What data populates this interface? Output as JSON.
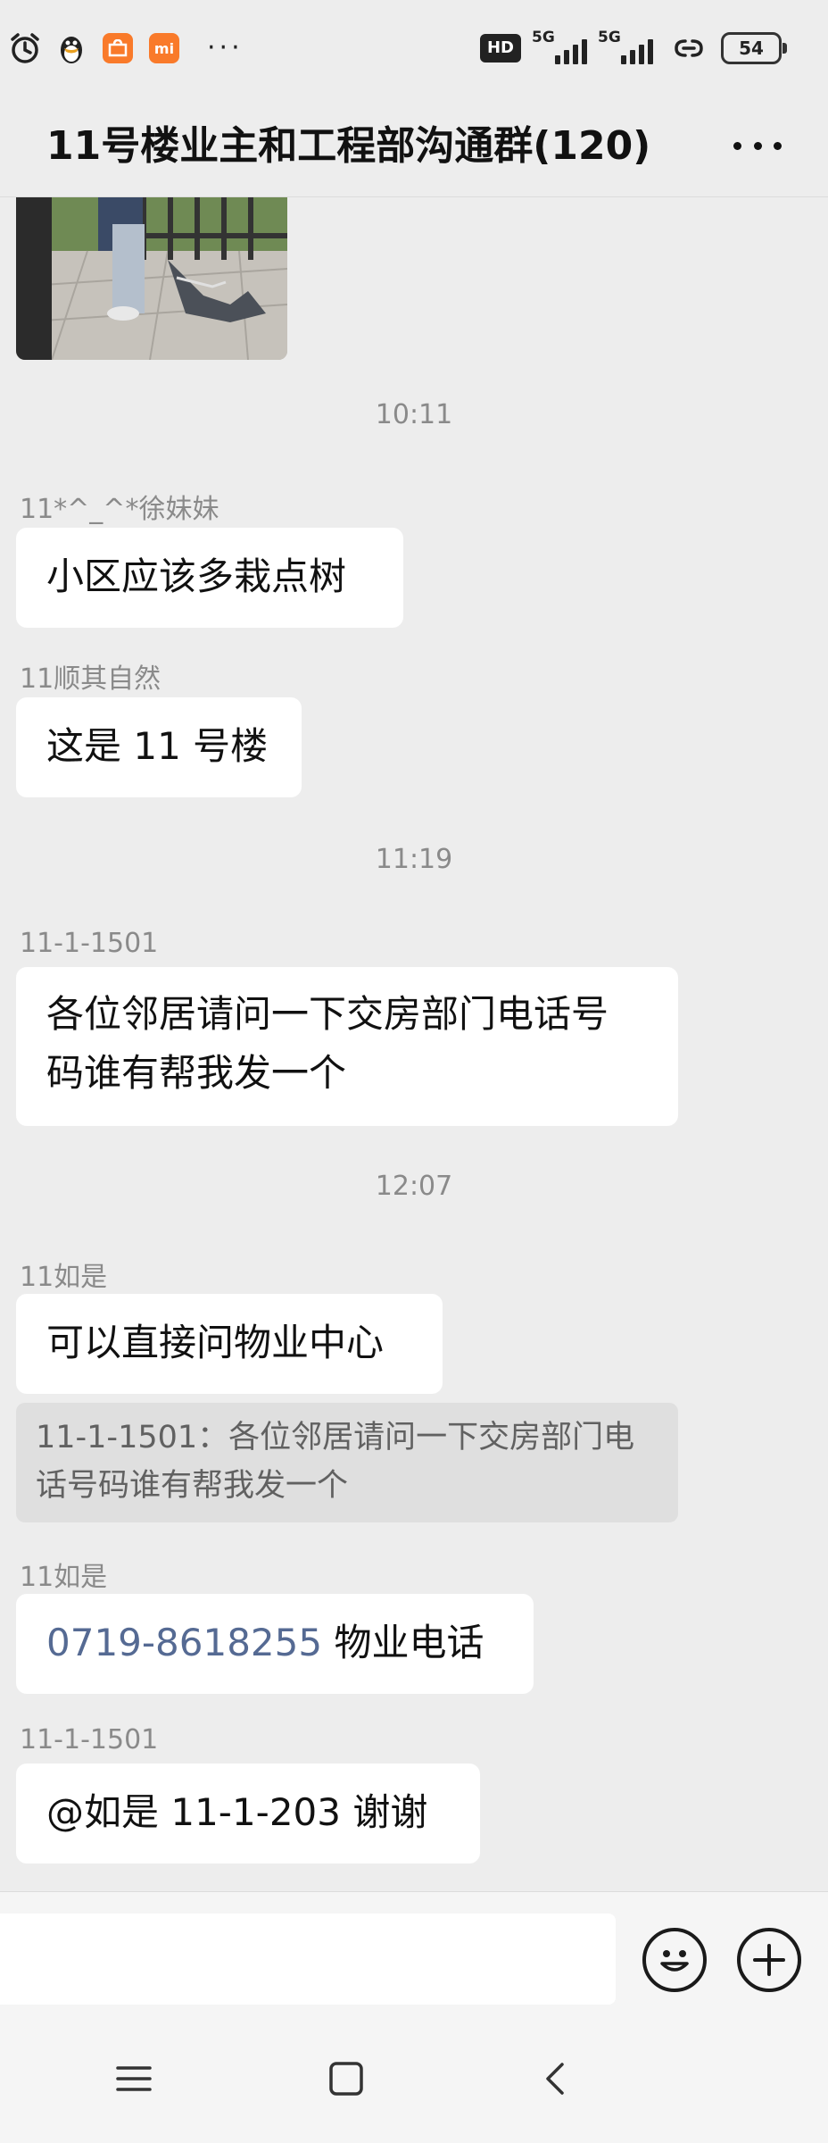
{
  "status_bar": {
    "icons": [
      "alarm-icon",
      "qq-penguin-icon",
      "taobao-app-icon",
      "mi-app-icon"
    ],
    "more_dots": "···",
    "hd_badge": "HD",
    "signal_1": "5G",
    "signal_2": "5G",
    "battery": "54"
  },
  "header": {
    "title": "11号楼业主和工程部沟通群(120)",
    "more_icon": "more-icon"
  },
  "messages": [
    {
      "type": "image",
      "description": "balcony-photo"
    },
    {
      "type": "time",
      "text": "10:11"
    },
    {
      "type": "text",
      "sender": "11*^_^*徐妹妹",
      "text": "小区应该多栽点树"
    },
    {
      "type": "text",
      "sender": "11顺其自然",
      "text": "这是 11 号楼"
    },
    {
      "type": "time",
      "text": "11:19"
    },
    {
      "type": "text",
      "sender": "11-1-1501",
      "line1": "各位邻居请问一下交房部门电话号",
      "line2": "码谁有帮我发一个"
    },
    {
      "type": "time",
      "text": "12:07"
    },
    {
      "type": "text",
      "sender": "11如是",
      "text": "可以直接问物业中心",
      "quote_line1": "11-1-1501：各位邻居请问一下交房部门电",
      "quote_line2": "话号码谁有帮我发一个"
    },
    {
      "type": "text",
      "sender": "11如是",
      "phone": "0719-8618255",
      "text": " 物业电话"
    },
    {
      "type": "text",
      "sender": "11-1-1501",
      "text": "@如是 11-1-203  谢谢"
    }
  ],
  "input_bar": {
    "emoji_icon": "emoji-icon",
    "plus_icon": "plus-icon"
  },
  "nav_bar": {
    "menu_icon": "menu-icon",
    "home_icon": "home-icon",
    "back_icon": "back-icon"
  }
}
